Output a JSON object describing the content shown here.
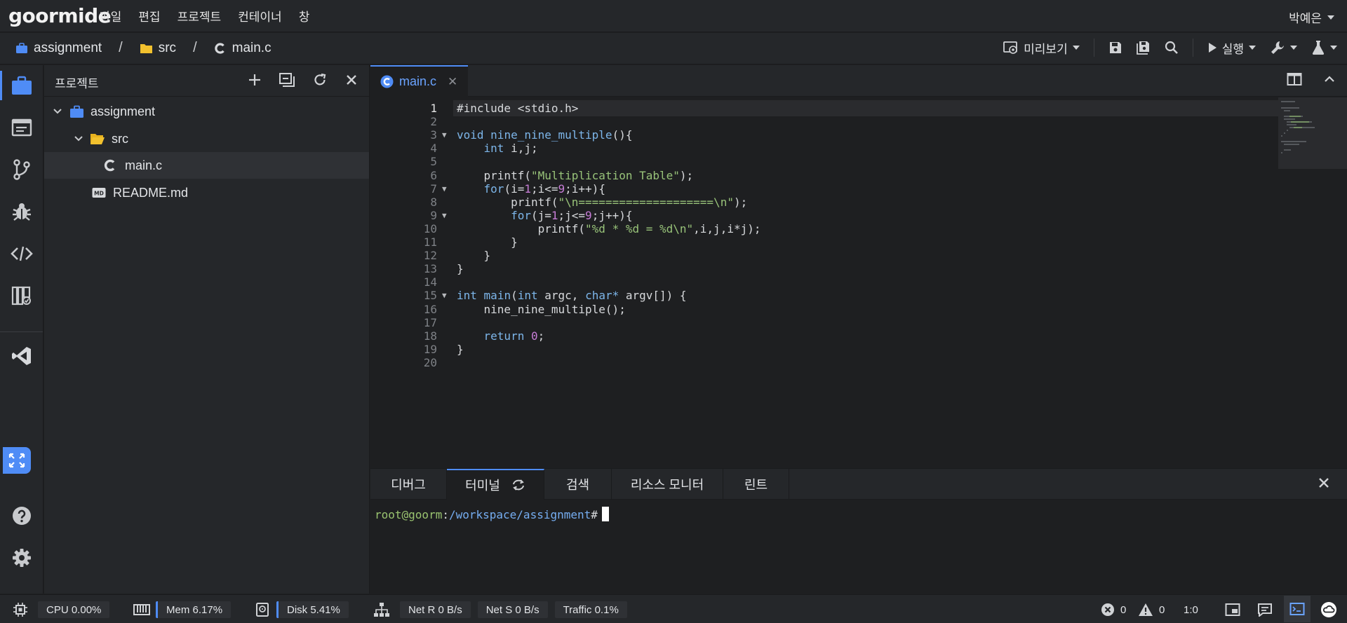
{
  "app": {
    "logo": "goormide"
  },
  "menu": [
    "파일",
    "편집",
    "프로젝트",
    "컨테이너",
    "창"
  ],
  "user": {
    "name": "박예은"
  },
  "breadcrumb": [
    {
      "label": "assignment",
      "icon": "briefcase-icon"
    },
    {
      "label": "src",
      "icon": "folder-icon"
    },
    {
      "label": "main.c",
      "icon": "c-file-icon"
    }
  ],
  "toolbar": {
    "preview_label": "미리보기",
    "run_label": "실행"
  },
  "explorer": {
    "title": "프로젝트",
    "tree": [
      {
        "label": "assignment",
        "type": "project"
      },
      {
        "label": "src",
        "type": "folder"
      },
      {
        "label": "main.c",
        "type": "c-file",
        "selected": true
      },
      {
        "label": "README.md",
        "type": "md-file"
      }
    ]
  },
  "editor": {
    "tab_label": "main.c",
    "current_line": 1,
    "lines": [
      {
        "n": "1",
        "html": "<span class=\"pp\">#include &lt;stdio.h&gt;</span>"
      },
      {
        "n": "2",
        "html": ""
      },
      {
        "n": "3",
        "fold": true,
        "html": "<span class=\"kw\">void</span> <span class=\"kw\">nine_nine_multiple</span>(){"
      },
      {
        "n": "4",
        "html": "    <span class=\"kw\">int</span> i,j;"
      },
      {
        "n": "5",
        "html": ""
      },
      {
        "n": "6",
        "html": "    printf(<span class=\"str\">\"Multiplication Table\"</span>);"
      },
      {
        "n": "7",
        "fold": true,
        "html": "    <span class=\"kw\">for</span>(i=<span class=\"num\">1</span>;i&lt;=<span class=\"num\">9</span>;i++){"
      },
      {
        "n": "8",
        "html": "        printf(<span class=\"str\">\"\\n====================\\n\"</span>);"
      },
      {
        "n": "9",
        "fold": true,
        "html": "        <span class=\"kw\">for</span>(j=<span class=\"num\">1</span>;j&lt;=<span class=\"num\">9</span>;j++){"
      },
      {
        "n": "10",
        "html": "            printf(<span class=\"str\">\"%d * %d = %d\\n\"</span>,i,j,i*j);"
      },
      {
        "n": "11",
        "html": "        }"
      },
      {
        "n": "12",
        "html": "    }"
      },
      {
        "n": "13",
        "html": "}"
      },
      {
        "n": "14",
        "html": ""
      },
      {
        "n": "15",
        "fold": true,
        "html": "<span class=\"kw\">int</span> <span class=\"kw\">main</span>(<span class=\"kw\">int</span> argc, <span class=\"kw\">char*</span> argv[]) {"
      },
      {
        "n": "16",
        "html": "    nine_nine_multiple();"
      },
      {
        "n": "17",
        "html": ""
      },
      {
        "n": "18",
        "html": "    <span class=\"kw\">return</span> <span class=\"num\">0</span>;"
      },
      {
        "n": "19",
        "html": "}"
      },
      {
        "n": "20",
        "html": ""
      }
    ]
  },
  "panel": {
    "tabs": [
      "디버그",
      "터미널",
      "검색",
      "리소스 모니터",
      "린트"
    ],
    "active_tab": "터미널"
  },
  "terminal": {
    "user": "root@goorm",
    "sep": ":",
    "path": "/workspace/assignment",
    "prompt": "#"
  },
  "status": {
    "cpu": "CPU 0.00%",
    "mem": "Mem 6.17%",
    "disk": "Disk 5.41%",
    "net_r": "Net R 0 B/s",
    "net_s": "Net S 0 B/s",
    "traffic": "Traffic 0.1%",
    "errors": "0",
    "warnings": "0",
    "cursor_pos": "1:0"
  },
  "colors": {
    "accent": "#4f8cf6",
    "background": "#1e1f21",
    "panel": "#25272a"
  }
}
